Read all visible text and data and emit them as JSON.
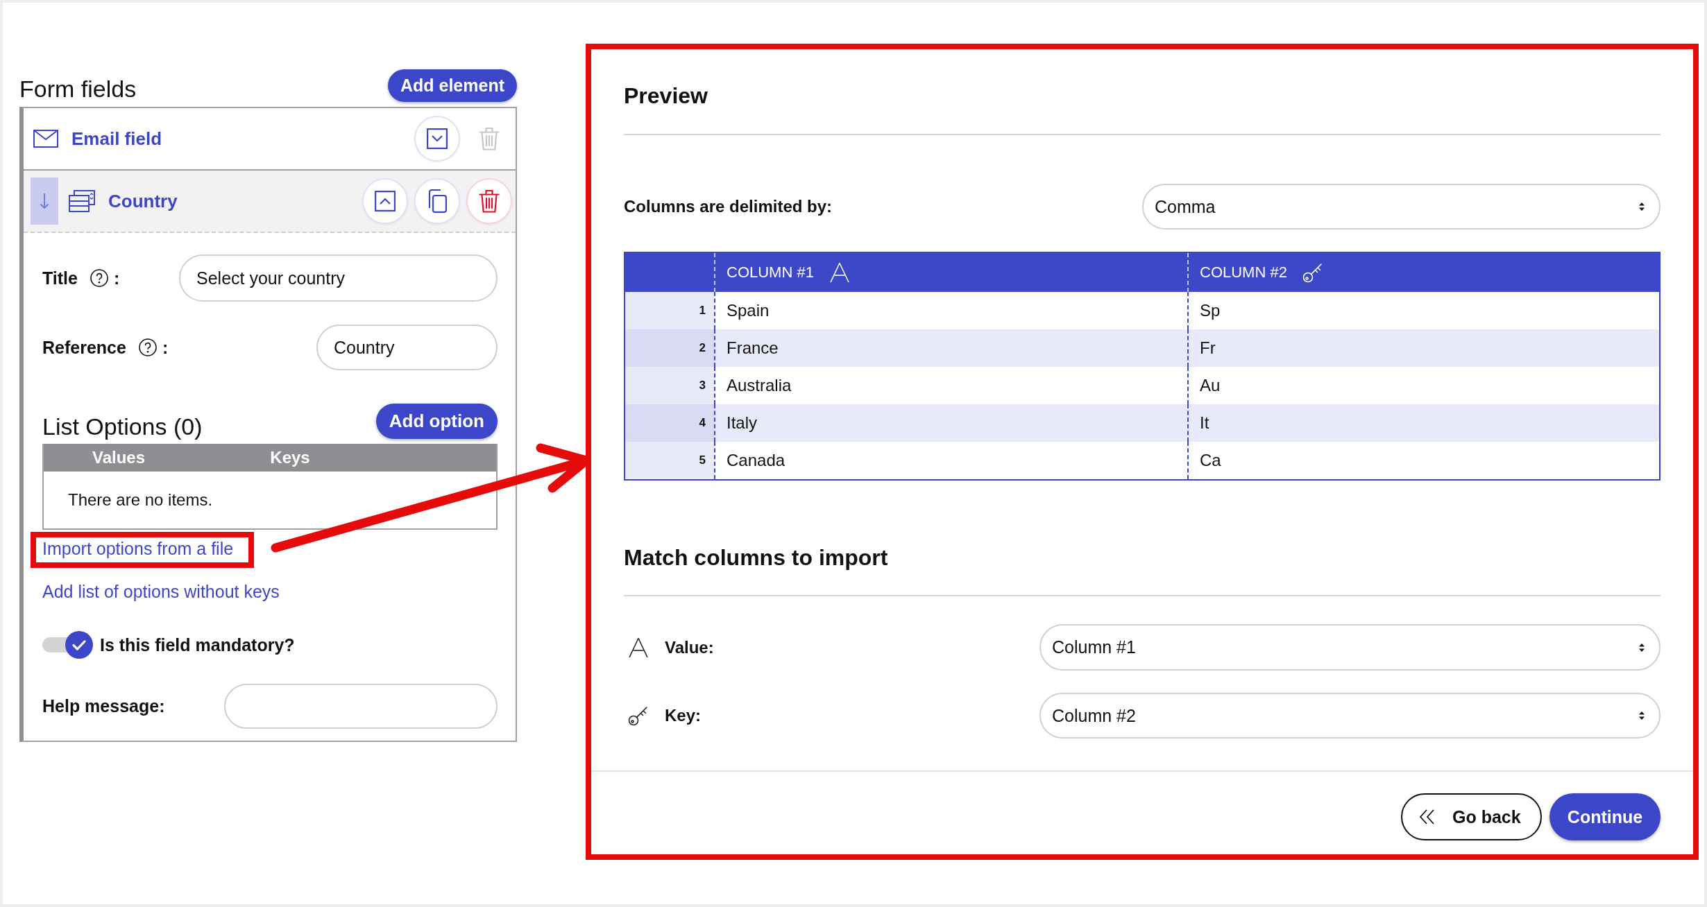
{
  "form_fields": {
    "title": "Form fields",
    "add_button": "Add element",
    "fields": [
      {
        "kind": "email",
        "label": "Email field",
        "expanded": false,
        "actions": [
          {
            "kind": "move_down",
            "disabled": false
          },
          {
            "kind": "delete",
            "disabled": true
          }
        ]
      },
      {
        "kind": "list",
        "label": "Country",
        "expanded": true,
        "actions": [
          {
            "kind": "move_up",
            "disabled": false
          },
          {
            "kind": "duplicate",
            "disabled": false
          },
          {
            "kind": "delete",
            "disabled": false
          }
        ],
        "settings": {
          "title": {
            "label": "Title",
            "separator": ":",
            "value": "Select your country"
          },
          "reference": {
            "label": "Reference",
            "separator": ":",
            "value": "Country"
          },
          "list_options": {
            "title": "List Options (0)",
            "add_button": "Add option",
            "columns": [
              "Values",
              "Keys"
            ],
            "empty_message": "There are no items."
          },
          "links": [
            {
              "text": "Import options from a file",
              "highlighted": true
            },
            {
              "text": "Add list of options without keys",
              "highlighted": false
            }
          ],
          "mandatory": {
            "label": "Is this field mandatory?",
            "on": true
          },
          "help_message": {
            "label": "Help message:"
          }
        }
      }
    ]
  },
  "callout_arrow": true,
  "import_dialog": {
    "highlighted": true,
    "preview": {
      "title": "Preview",
      "delimiter": {
        "label": "Columns are delimited by:",
        "value": "Comma"
      },
      "table": {
        "columns": [
          {
            "label": "COLUMN #1",
            "kind": "value"
          },
          {
            "label": "COLUMN #2",
            "kind": "key"
          }
        ],
        "rows": [
          {
            "number": "1",
            "cells": [
              "Spain",
              "Sp"
            ]
          },
          {
            "number": "2",
            "cells": [
              "France",
              "Fr"
            ]
          },
          {
            "number": "3",
            "cells": [
              "Australia",
              "Au"
            ]
          },
          {
            "number": "4",
            "cells": [
              "Italy",
              "It"
            ]
          },
          {
            "number": "5",
            "cells": [
              "Canada",
              "Ca"
            ]
          }
        ]
      }
    },
    "match": {
      "title": "Match columns to import",
      "rows": [
        {
          "kind": "value",
          "label": "Value:",
          "value": "Column #1"
        },
        {
          "kind": "key",
          "label": "Key:",
          "value": "Column #2"
        }
      ]
    },
    "buttons": [
      {
        "kind": "back",
        "label": "Go back"
      },
      {
        "kind": "primary",
        "label": "Continue"
      }
    ]
  }
}
